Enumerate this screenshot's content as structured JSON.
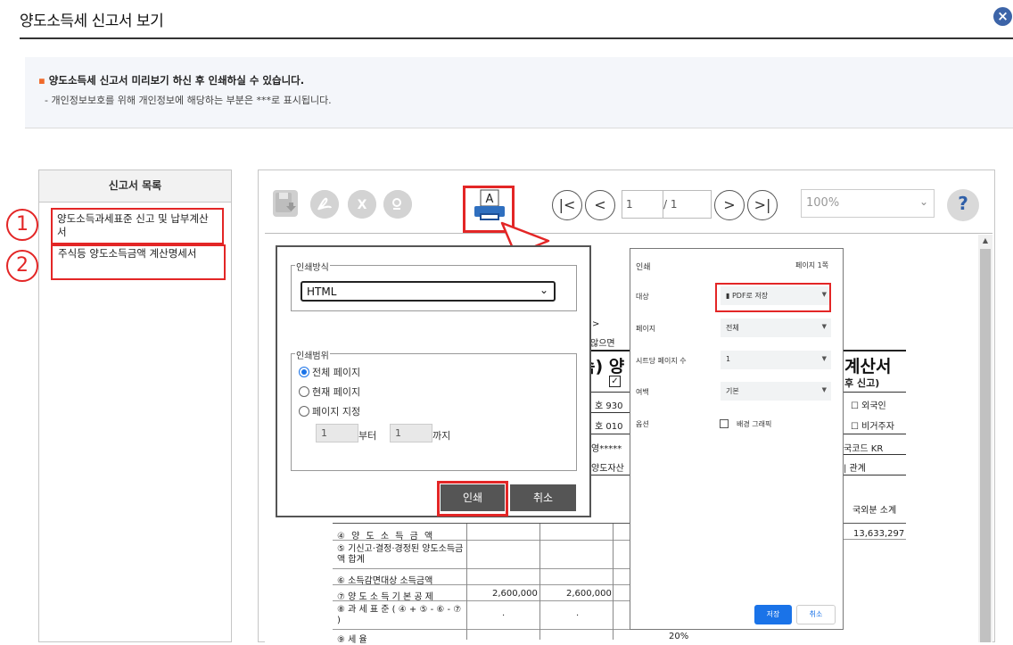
{
  "header": {
    "title": "양도소득세 신고서 보기",
    "close_icon": "×"
  },
  "notice": {
    "line1": "양도소득세 신고서 미리보기 하신 후 인쇄하실 수 있습니다.",
    "line2": "- 개인정보보호를 위해 개인정보에 해당하는 부분은  ***로 표시됩니다."
  },
  "list": {
    "heading": "신고서 목록",
    "items": [
      {
        "number": "1",
        "label": "양도소득과세표준 신고 및 납부계산서"
      },
      {
        "number": "2",
        "label": "주식등 양도소득금액 계산명세서"
      }
    ]
  },
  "toolbar": {
    "print_glyph": "A",
    "first": "|<",
    "prev": "<",
    "next": ">",
    "last": ">|",
    "page_value": "1",
    "page_total": "/ 1",
    "zoom": "100%",
    "help": "?"
  },
  "doc": {
    "frag_gt": ">",
    "frag_ato": "않으면",
    "frag_title_l": "속) 양",
    "frag_title_r": "계산서",
    "frag_sub_r": "후 신고)",
    "frag_930": "호  930",
    "frag_010": "호  010",
    "frag_mask": "영*****",
    "frag_asset": "양도자산",
    "frag_foreigner": "외국인",
    "frag_resident": "비거주자",
    "frag_country": "국코드  KR",
    "frag_relation": "| 관계",
    "frag_subtotal": "국외분 소계",
    "frag_amount": "13,633,297",
    "frag_rate": "20%",
    "rows": [
      {
        "label": "④ 양   도   소   득   금   액",
        "c1": "",
        "c2": ""
      },
      {
        "label": "⑤ 기신고·결정·경정된 양도소득금액 합계",
        "c1": "",
        "c2": ""
      },
      {
        "label": "⑥ 소득감면대상 소득금액",
        "c1": "",
        "c2": ""
      },
      {
        "label": "⑦ 양 도 소 득 기 본 공 제",
        "c1": "2,600,000",
        "c2": "2,600,000"
      },
      {
        "label": "⑧ 과     세     표     준 ( ④ + ⑤ - ⑥ - ⑦ )",
        "c1": "·",
        "c2": "·"
      },
      {
        "label": "⑨ 세             율",
        "c1": "",
        "c2": ""
      }
    ]
  },
  "dialog1": {
    "method_legend": "인쇄방식",
    "method_value": "HTML",
    "range_legend": "인쇄범위",
    "radio_all": "전체 페이지",
    "radio_current": "현재 페이지",
    "radio_pages": "페이지 지정",
    "from_value": "1",
    "from_label": "부터",
    "to_value": "1",
    "to_label": "까지",
    "print_label": "인쇄",
    "cancel_label": "취소"
  },
  "dialog2": {
    "title": "인쇄",
    "page_count": "페이지 1쪽",
    "dest_label": "대상",
    "dest_value": "PDF로 저장",
    "pages_label": "페이지",
    "pages_value": "전체",
    "sheet_label": "시트당 페이지 수",
    "sheet_value": "1",
    "margin_label": "여백",
    "margin_value": "기본",
    "options_label": "옵션",
    "bg_label": "배경 그래픽",
    "save_label": "저장",
    "cancel_label": "취소"
  },
  "colors": {
    "accent_red": "#e32626",
    "close_blue": "#3c64a8",
    "chrome_blue": "#1a73e8"
  }
}
